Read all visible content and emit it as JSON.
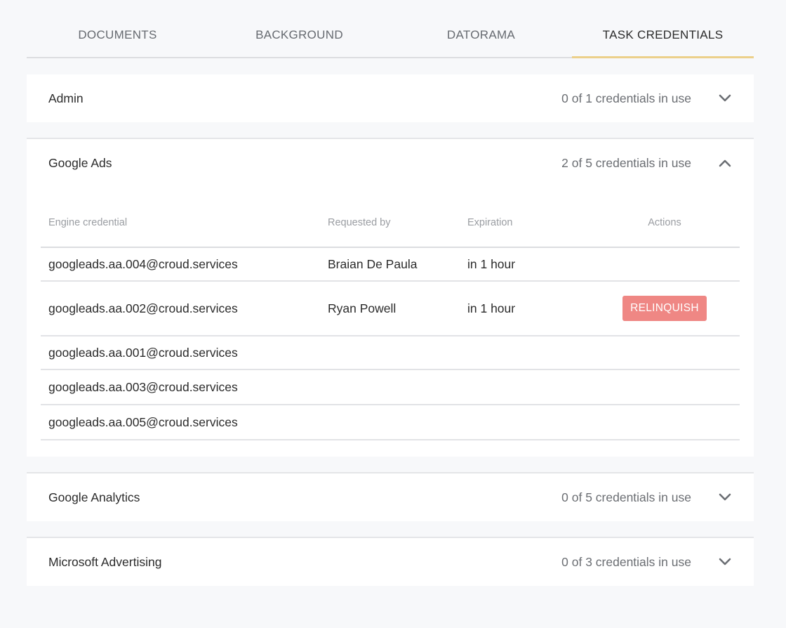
{
  "tabs": [
    {
      "label": "DOCUMENTS",
      "active": false
    },
    {
      "label": "BACKGROUND",
      "active": false
    },
    {
      "label": "DATORAMA",
      "active": false
    },
    {
      "label": "TASK CREDENTIALS",
      "active": true
    }
  ],
  "panels": [
    {
      "title": "Admin",
      "count": "0 of 1 credentials in use",
      "expanded": false
    },
    {
      "title": "Google Ads",
      "count": "2 of 5 credentials in use",
      "expanded": true
    },
    {
      "title": "Google Analytics",
      "count": "0 of 5 credentials in use",
      "expanded": false
    },
    {
      "title": "Microsoft Advertising",
      "count": "0 of 3 credentials in use",
      "expanded": false
    }
  ],
  "table": {
    "headers": [
      "Engine credential",
      "Requested by",
      "Expiration",
      "Actions"
    ],
    "rows": [
      {
        "credential": "googleads.aa.004@croud.services",
        "requested_by": "Braian De Paula",
        "expiration": "in 1 hour",
        "action": ""
      },
      {
        "credential": "googleads.aa.002@croud.services",
        "requested_by": "Ryan Powell",
        "expiration": "in 1 hour",
        "action": "RELINQUISH"
      },
      {
        "credential": "googleads.aa.001@croud.services",
        "requested_by": "",
        "expiration": "",
        "action": ""
      },
      {
        "credential": "googleads.aa.003@croud.services",
        "requested_by": "",
        "expiration": "",
        "action": ""
      },
      {
        "credential": "googleads.aa.005@croud.services",
        "requested_by": "",
        "expiration": "",
        "action": ""
      }
    ]
  },
  "icons": {
    "collapsed": "chevron-down-icon",
    "expanded": "chevron-up-icon"
  },
  "colors": {
    "accent_underline": "#ecd08a",
    "relinquish_button": "#ef8784"
  }
}
